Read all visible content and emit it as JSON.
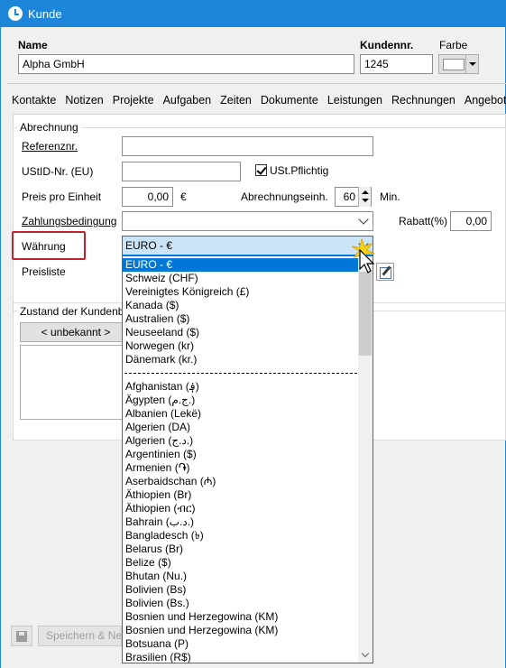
{
  "window": {
    "title": "Kunde"
  },
  "header": {
    "name_label": "Name",
    "name_value": "Alpha GmbH",
    "number_label": "Kundennr.",
    "number_value": "1245",
    "color_label": "Farbe"
  },
  "tabs": [
    "Kontakte",
    "Notizen",
    "Projekte",
    "Aufgaben",
    "Zeiten",
    "Dokumente",
    "Leistungen",
    "Rechnungen",
    "Angebote"
  ],
  "billing": {
    "group_title": "Abrechnung",
    "reference_label": "Referenznr.",
    "vat_id_label": "UStID-Nr. (EU)",
    "vat_liable_label": "USt.Pflichtig",
    "vat_liable_checked": true,
    "price_unit_label": "Preis pro Einheit",
    "price_unit_value": "0,00",
    "currency_symbol": "€",
    "billing_unit_label": "Abrechnungseinh.",
    "billing_unit_value": "60",
    "billing_unit_suffix": "Min.",
    "payment_terms_label": "Zahlungsbedingung",
    "discount_label": "Rabatt(%)",
    "discount_value": "0,00",
    "currency_label": "Währung",
    "currency_selected": "EURO - €",
    "price_list_label": "Preisliste"
  },
  "state": {
    "group_title": "Zustand der Kundenb",
    "button_label": "< unbekannt >"
  },
  "currency_options_top": [
    "EURO - €",
    "Schweiz (CHF)",
    "Vereinigtes Königreich (£)",
    "Kanada ($)",
    "Australien ($)",
    "Neuseeland ($)",
    "Norwegen (kr)",
    "Dänemark (kr.)"
  ],
  "currency_options_rest": [
    "Afghanistan (؋)",
    "Ägypten (ج.م.)",
    "Albanien (Lekë)",
    "Algerien (DA)",
    "Algerien (د.ج.)",
    "Argentinien ($)",
    "Armenien (֏)",
    "Aserbaidschan (₼)",
    "Äthiopien (Br)",
    "Äthiopien (ብር)",
    "Bahrain (د.ب.)",
    "Bangladesch (৳)",
    "Belarus (Br)",
    "Belize ($)",
    "Bhutan (Nu.)",
    "Bolivien (Bs)",
    "Bolivien (Bs.)",
    "Bosnien und Herzegowina (KM)",
    "Bosnien und Herzegowina (KM)",
    "Botsuana (P)",
    "Brasilien (R$)"
  ],
  "footer": {
    "save_label": "Speichern & Ne"
  },
  "colors": {
    "titlebar": "#1d86d8",
    "selection": "#0078d7",
    "highlight_border": "#c0232b"
  }
}
